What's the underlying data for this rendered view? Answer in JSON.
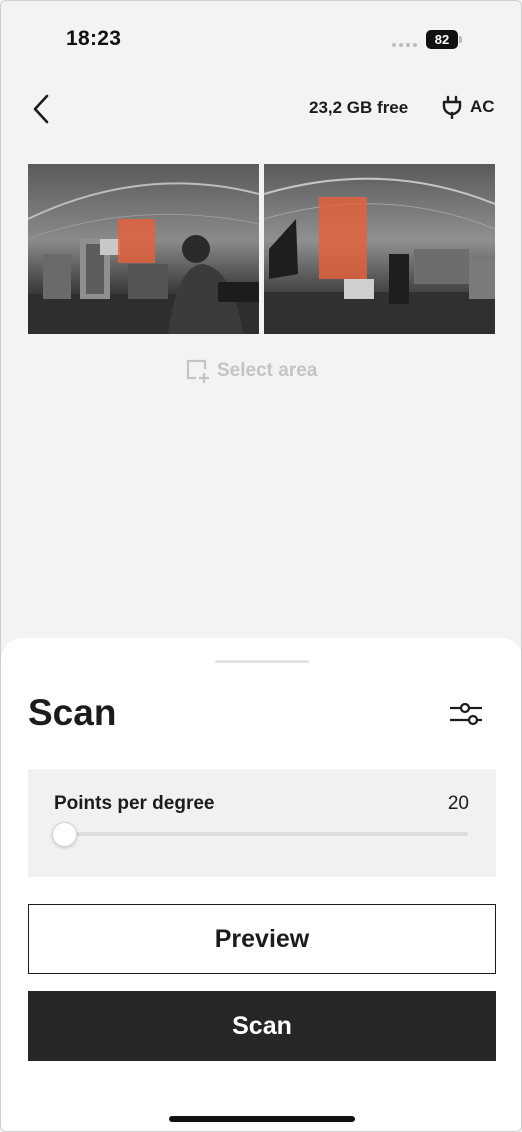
{
  "status_bar": {
    "time": "18:23",
    "battery_level": "82"
  },
  "header": {
    "storage_free": "23,2 GB free",
    "power_source": "AC"
  },
  "panorama": {
    "select_area_label": "Select area",
    "highlight_color": "#e8603a"
  },
  "sheet": {
    "title": "Scan",
    "parameter": {
      "label": "Points per degree",
      "value": "20"
    },
    "preview_button": "Preview",
    "scan_button": "Scan"
  },
  "icons": {
    "back": "chevron-left-icon",
    "power": "plug-icon",
    "select_area": "select-area-icon",
    "settings": "sliders-icon"
  }
}
